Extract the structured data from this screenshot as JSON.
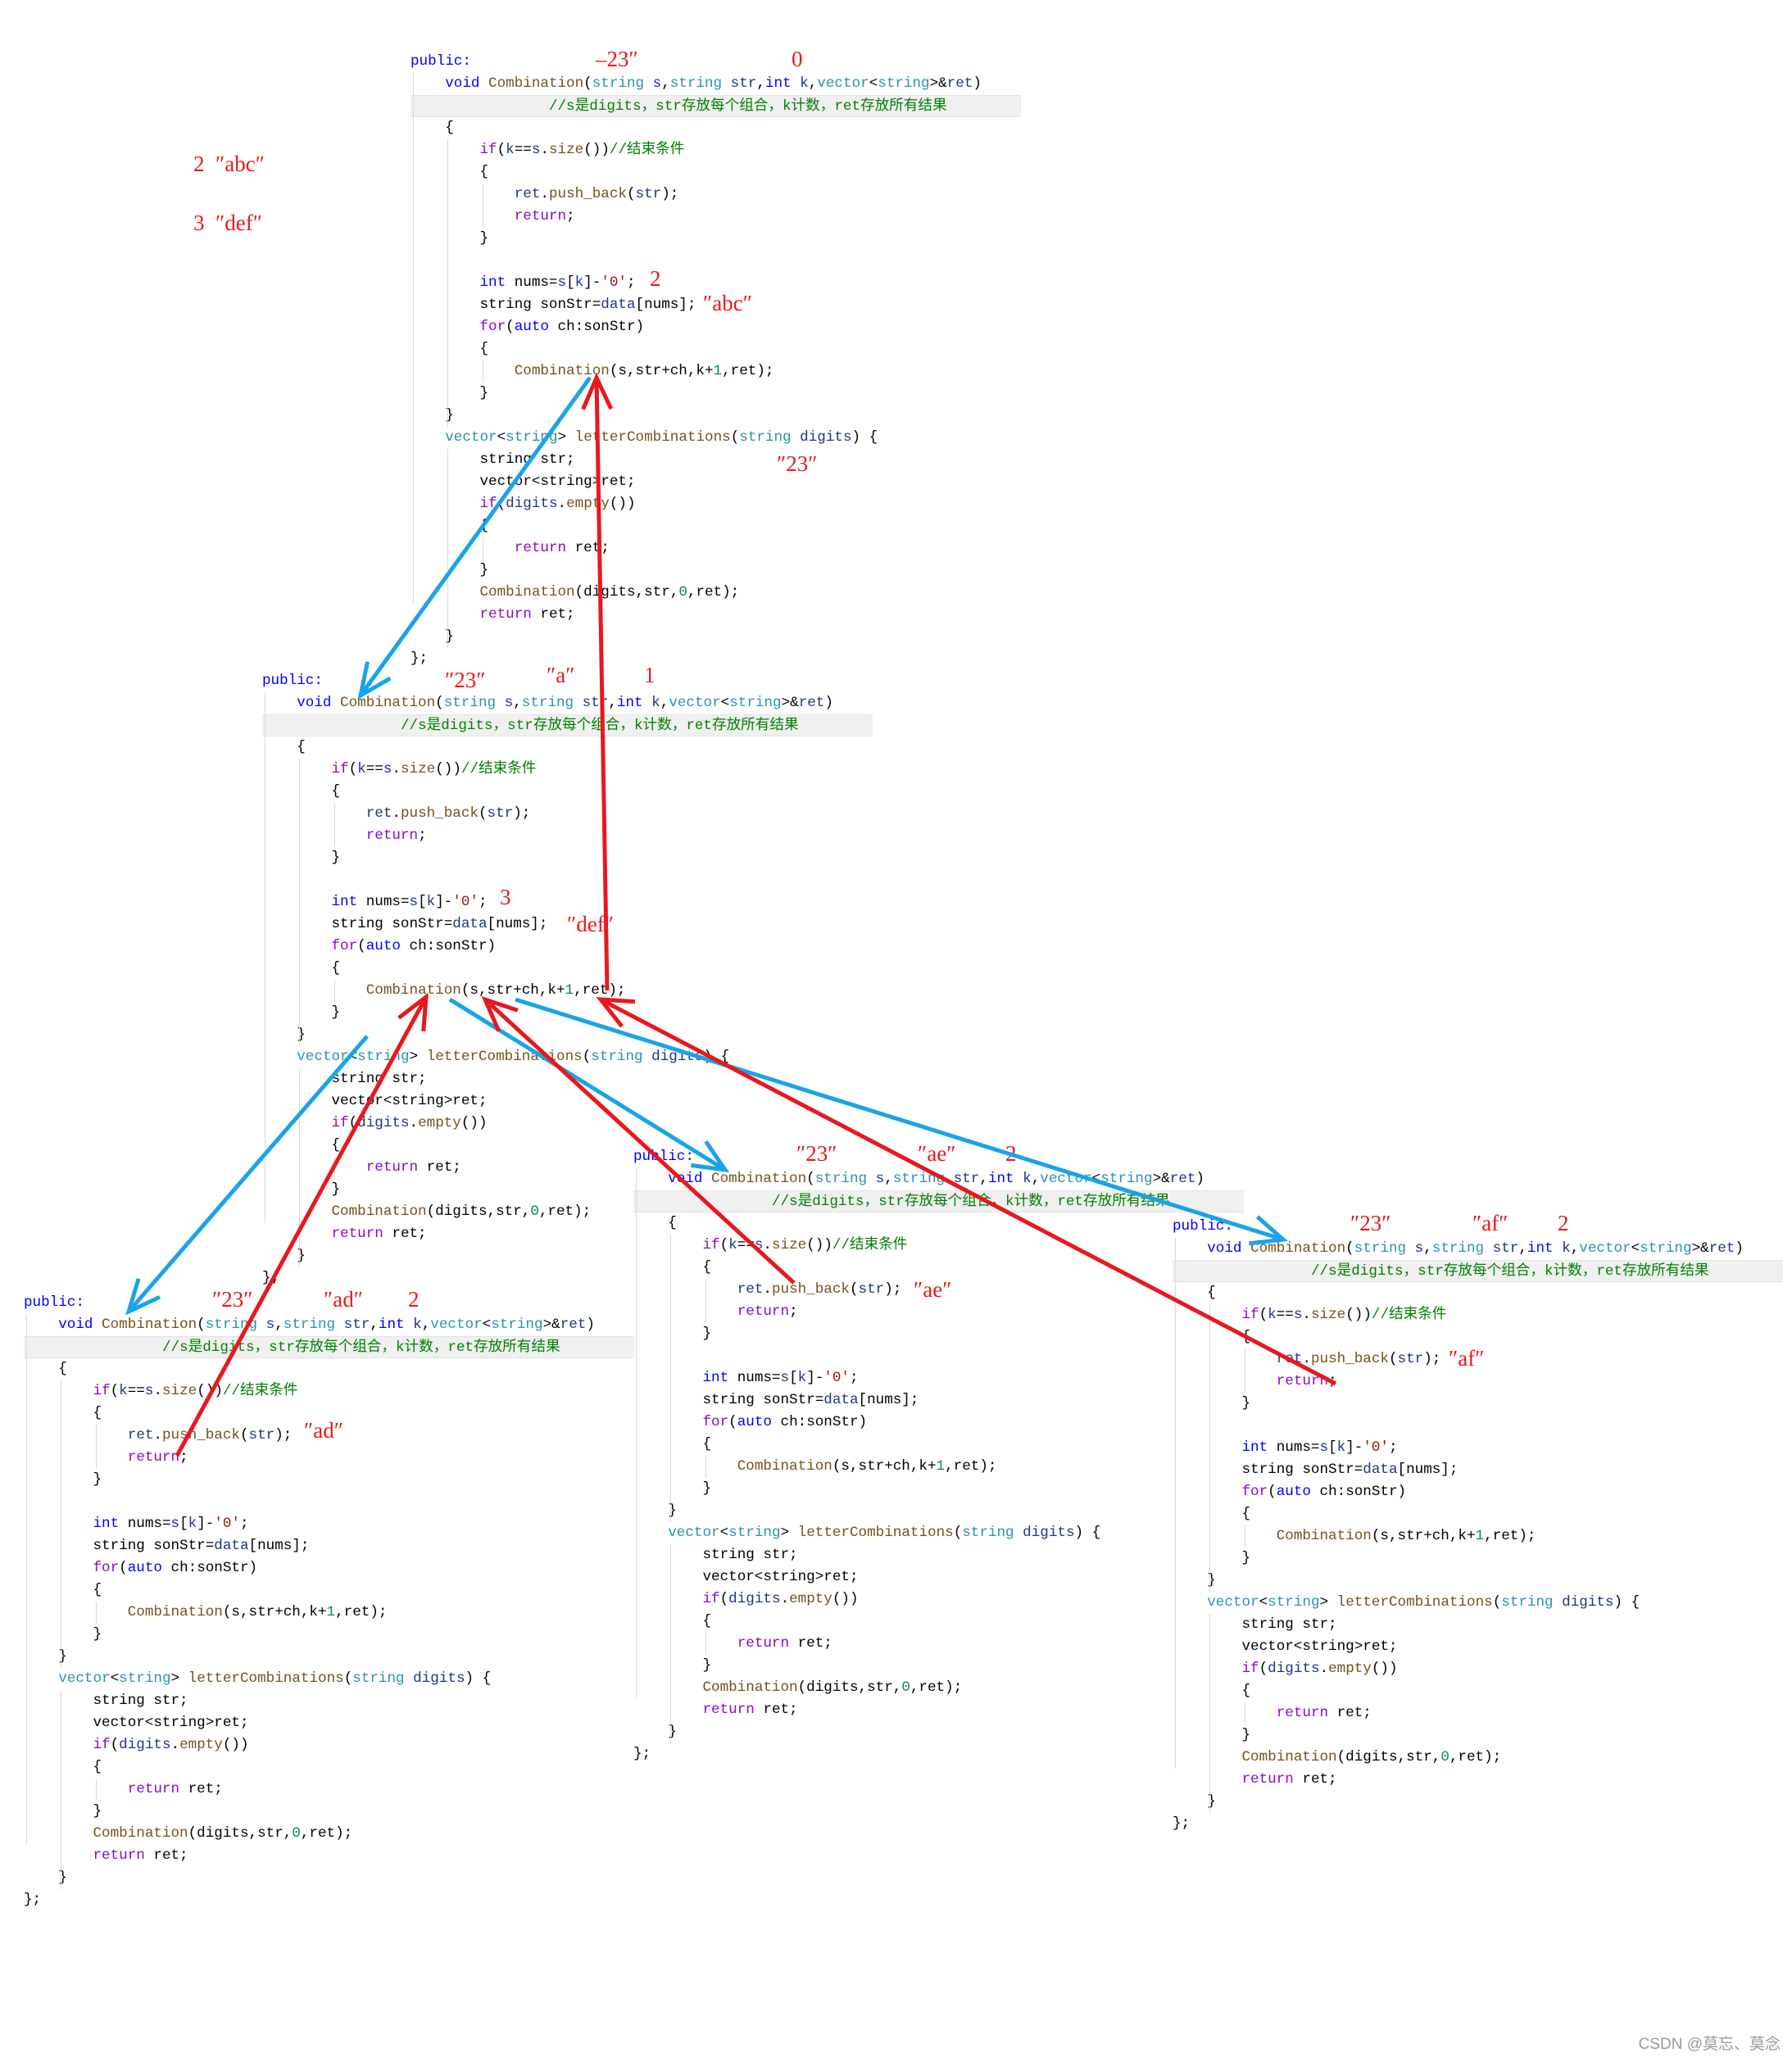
{
  "code_lines": [
    [
      [
        "k",
        "public:"
      ]
    ],
    [
      [
        "p",
        "    "
      ],
      [
        "k",
        "void "
      ],
      [
        "f",
        "Combination"
      ],
      [
        "p",
        "("
      ],
      [
        "t",
        "string "
      ],
      [
        "v",
        "s"
      ],
      [
        "p",
        ","
      ],
      [
        "t",
        "string "
      ],
      [
        "v",
        "str"
      ],
      [
        "p",
        ","
      ],
      [
        "k",
        "int "
      ],
      [
        "v",
        "k"
      ],
      [
        "p",
        ","
      ],
      [
        "t",
        "vector"
      ],
      [
        "p",
        "<"
      ],
      [
        "t",
        "string"
      ],
      [
        "p",
        ">&"
      ],
      [
        "v",
        "ret"
      ],
      [
        "p",
        ")"
      ]
    ],
    [
      [
        "p",
        "                "
      ],
      [
        "m",
        "//s是digits，str存放每个组合，k计数，ret存放所有结果"
      ]
    ],
    [
      [
        "p",
        "    {"
      ]
    ],
    [
      [
        "p",
        "        "
      ],
      [
        "c",
        "if"
      ],
      [
        "p",
        "("
      ],
      [
        "v",
        "k"
      ],
      [
        "p",
        "=="
      ],
      [
        "v",
        "s"
      ],
      [
        "p",
        "."
      ],
      [
        "f",
        "size"
      ],
      [
        "p",
        "())"
      ],
      [
        "m",
        "//结束条件"
      ]
    ],
    [
      [
        "p",
        "        {"
      ]
    ],
    [
      [
        "p",
        "            "
      ],
      [
        "v",
        "ret"
      ],
      [
        "p",
        "."
      ],
      [
        "f",
        "push_back"
      ],
      [
        "p",
        "("
      ],
      [
        "v",
        "str"
      ],
      [
        "p",
        ");"
      ]
    ],
    [
      [
        "p",
        "            "
      ],
      [
        "c",
        "return"
      ],
      [
        "p",
        ";"
      ]
    ],
    [
      [
        "p",
        "        }"
      ]
    ],
    [
      [
        "p",
        ""
      ]
    ],
    [
      [
        "p",
        "        "
      ],
      [
        "k",
        "int "
      ],
      [
        "p",
        "nums="
      ],
      [
        "v",
        "s"
      ],
      [
        "p",
        "["
      ],
      [
        "v",
        "k"
      ],
      [
        "p",
        "]-"
      ],
      [
        "s",
        "'0'"
      ],
      [
        "p",
        ";"
      ]
    ],
    [
      [
        "p",
        "        string sonStr="
      ],
      [
        "v",
        "data"
      ],
      [
        "p",
        "[nums];"
      ]
    ],
    [
      [
        "p",
        "        "
      ],
      [
        "c",
        "for"
      ],
      [
        "p",
        "("
      ],
      [
        "k",
        "auto "
      ],
      [
        "p",
        "ch:sonStr)"
      ]
    ],
    [
      [
        "p",
        "        {"
      ]
    ],
    [
      [
        "p",
        "            "
      ],
      [
        "f",
        "Combination"
      ],
      [
        "p",
        "(s,str+ch,k+"
      ],
      [
        "n",
        "1"
      ],
      [
        "p",
        ",ret);"
      ]
    ],
    [
      [
        "p",
        "        }"
      ]
    ],
    [
      [
        "p",
        "    }"
      ]
    ],
    [
      [
        "p",
        "    "
      ],
      [
        "t",
        "vector"
      ],
      [
        "p",
        "<"
      ],
      [
        "t",
        "string"
      ],
      [
        "p",
        "> "
      ],
      [
        "f",
        "letterCombinations"
      ],
      [
        "p",
        "("
      ],
      [
        "t",
        "string "
      ],
      [
        "v",
        "digits"
      ],
      [
        "p",
        ") {"
      ]
    ],
    [
      [
        "p",
        "        string str;"
      ]
    ],
    [
      [
        "p",
        "        vector<string>ret;"
      ]
    ],
    [
      [
        "p",
        "        "
      ],
      [
        "c",
        "if"
      ],
      [
        "p",
        "("
      ],
      [
        "v",
        "digits"
      ],
      [
        "p",
        "."
      ],
      [
        "f",
        "empty"
      ],
      [
        "p",
        "())"
      ]
    ],
    [
      [
        "p",
        "        {"
      ]
    ],
    [
      [
        "p",
        "            "
      ],
      [
        "c",
        "return"
      ],
      [
        "p",
        " ret;"
      ]
    ],
    [
      [
        "p",
        "        }"
      ]
    ],
    [
      [
        "p",
        "        "
      ],
      [
        "f",
        "Combination"
      ],
      [
        "p",
        "(digits,str,"
      ],
      [
        "n",
        "0"
      ],
      [
        "p",
        ",ret);"
      ]
    ],
    [
      [
        "p",
        "        "
      ],
      [
        "c",
        "return"
      ],
      [
        "p",
        " ret;"
      ]
    ],
    [
      [
        "p",
        "    }"
      ]
    ],
    [
      [
        "p",
        "};"
      ]
    ]
  ],
  "annotations": {
    "map2": "2  ″abc″",
    "map3": "3  ″def″",
    "b1_s": "–23″",
    "b1_k": "0",
    "b1_nums": "2",
    "b1_son": "″abc″",
    "b1_digits": "″23″",
    "b2_s": "″23″",
    "b2_str": "″a″",
    "b2_k": "1",
    "b2_nums": "3",
    "b2_son": "″def″",
    "b3_s": "″23″",
    "b3_str": "″ad″",
    "b3_k": "2",
    "b3_push": "″ad″",
    "b4_s": "″23″",
    "b4_str": "″ae″",
    "b4_k": "2",
    "b4_push": "″ae″",
    "b5_s": "″23″",
    "b5_str": "″af″",
    "b5_k": "2",
    "b5_push": "″af″"
  },
  "watermark": "CSDN @莫忘、莫念",
  "colors": {
    "call_arrow": "#1aa3e8",
    "return_arrow": "#e8181e"
  }
}
